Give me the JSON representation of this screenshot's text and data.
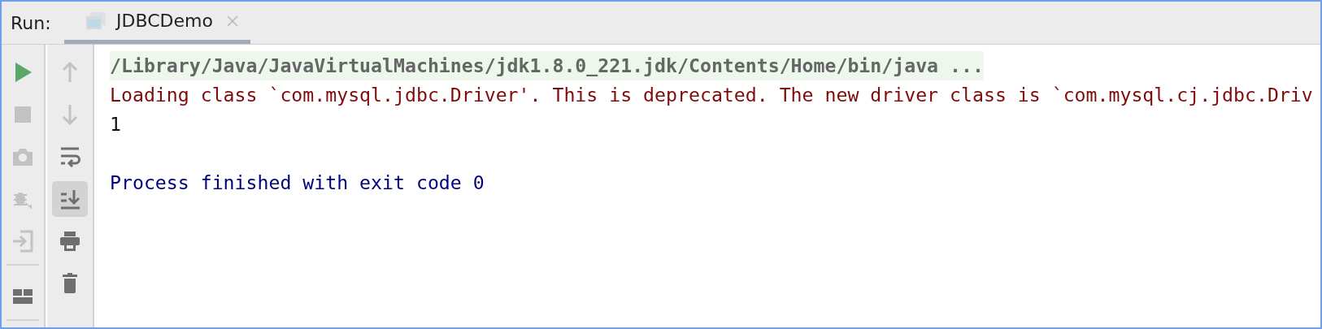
{
  "header": {
    "label": "Run:"
  },
  "tabs": [
    {
      "label": "JDBCDemo",
      "selected": true
    }
  ],
  "toolbar_left": [
    {
      "kind": "run",
      "disabled": false
    },
    {
      "kind": "stop",
      "disabled": true
    },
    {
      "kind": "camera",
      "disabled": true
    },
    {
      "kind": "bug",
      "disabled": true
    },
    {
      "kind": "enter",
      "disabled": true
    },
    {
      "kind": "separator"
    },
    {
      "kind": "layout",
      "disabled": false
    },
    {
      "kind": "separator"
    }
  ],
  "toolbar_right": [
    {
      "kind": "up",
      "disabled": true,
      "selected": false
    },
    {
      "kind": "down",
      "disabled": true,
      "selected": false
    },
    {
      "kind": "wrap",
      "disabled": false,
      "selected": false
    },
    {
      "kind": "scroll-end",
      "disabled": false,
      "selected": true
    },
    {
      "kind": "print",
      "disabled": false,
      "selected": false
    },
    {
      "kind": "trash",
      "disabled": false,
      "selected": false
    }
  ],
  "console": [
    {
      "kind": "command",
      "text": "/Library/Java/JavaVirtualMachines/jdk1.8.0_221.jdk/Contents/Home/bin/java ..."
    },
    {
      "kind": "error",
      "text": "Loading class `com.mysql.jdbc.Driver'. This is deprecated. The new driver class is `com.mysql.cj.jdbc.Driv"
    },
    {
      "kind": "output",
      "text": "1"
    },
    {
      "kind": "blank"
    },
    {
      "kind": "system",
      "text": "Process finished with exit code 0"
    }
  ]
}
